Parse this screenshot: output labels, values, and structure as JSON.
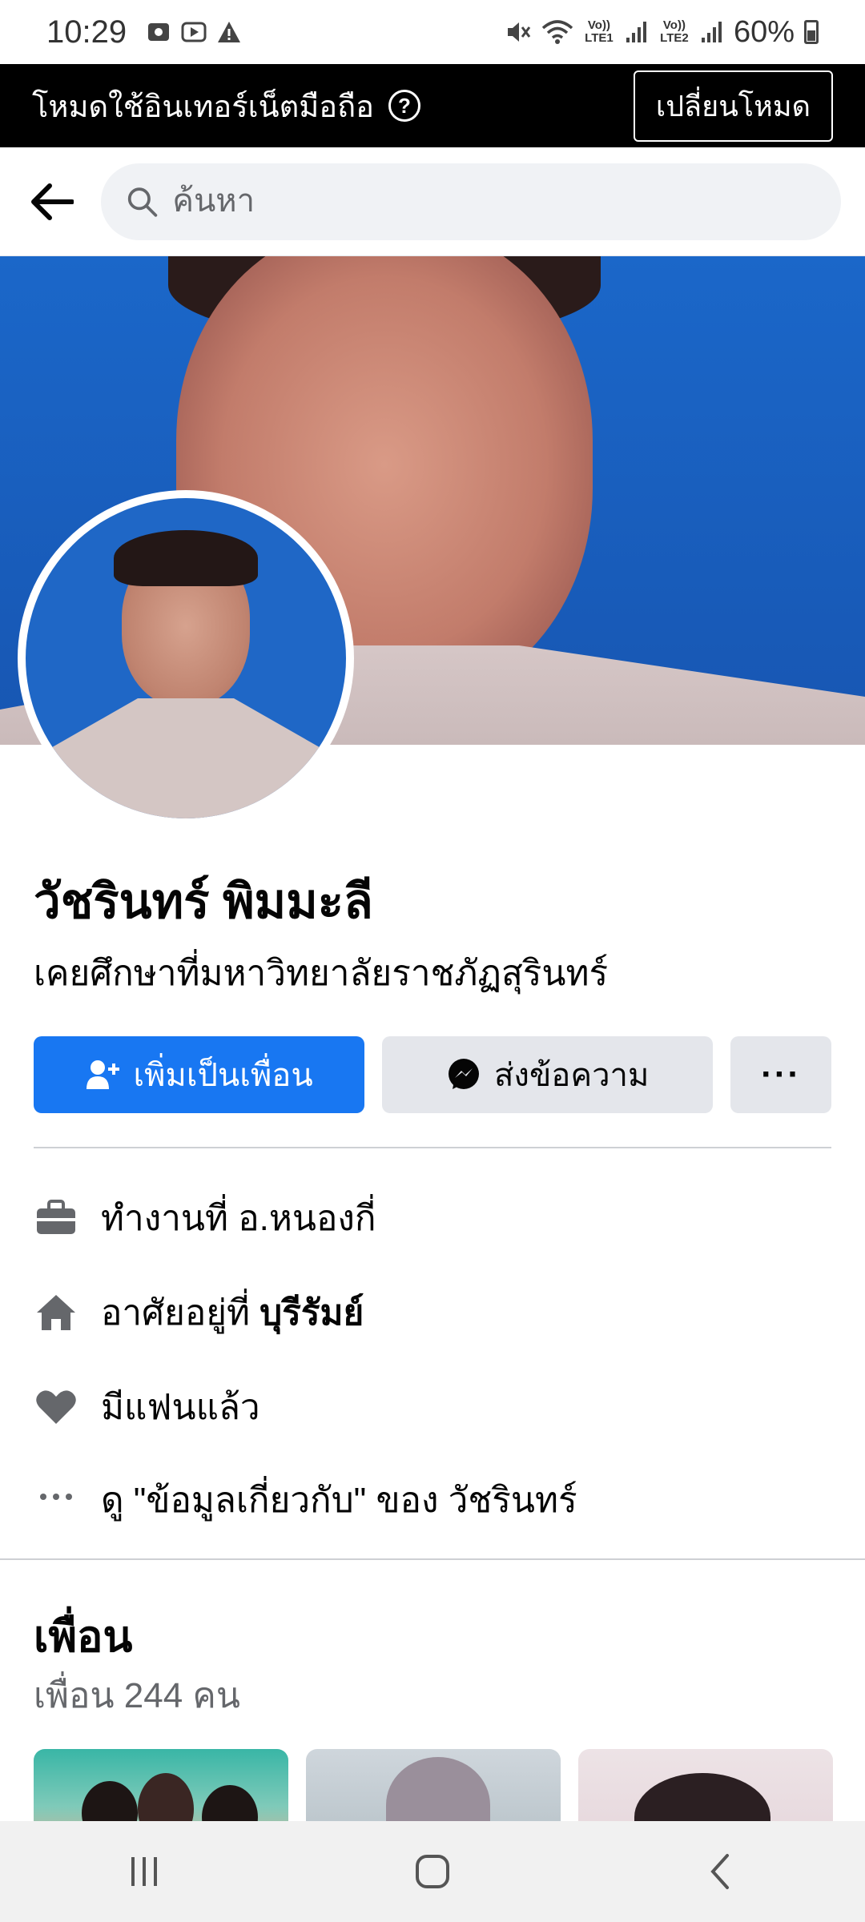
{
  "status_bar": {
    "time": "10:29",
    "lte1": "Vo)) LTE1",
    "lte2": "Vo)) LTE2",
    "battery": "60%"
  },
  "mode_banner": {
    "text": "โหมดใช้อินเทอร์เน็ตมือถือ",
    "help": "?",
    "switch_label": "เปลี่ยนโหมด"
  },
  "search": {
    "placeholder": "ค้นหา"
  },
  "profile": {
    "name": "วัชรินทร์ พิมมะลี",
    "bio": "เคยศึกษาที่มหาวิทยาลัยราชภัฏสุรินทร์"
  },
  "actions": {
    "add_friend": "เพิ่มเป็นเพื่อน",
    "message": "ส่งข้อความ",
    "more": "···"
  },
  "details": {
    "work": "ทำงานที่ อ.หนองกี่",
    "lives_prefix": "อาศัยอยู่ที่ ",
    "lives_place": "บุรีรัมย์",
    "relationship": "มีแฟนแล้ว",
    "about": "ดู \"ข้อมูลเกี่ยวกับ\" ของ วัชรินทร์"
  },
  "friends": {
    "title": "เพื่อน",
    "count": "เพื่อน 244 คน"
  },
  "icons": {
    "back": "back-arrow-icon",
    "search": "search-icon",
    "work": "briefcase-icon",
    "home": "home-icon",
    "relationship": "heart-icon",
    "more": "more-dots-icon"
  },
  "colors": {
    "primary": "#1877f2",
    "secondary_button": "#e4e6eb",
    "banner_bg": "#000000"
  }
}
